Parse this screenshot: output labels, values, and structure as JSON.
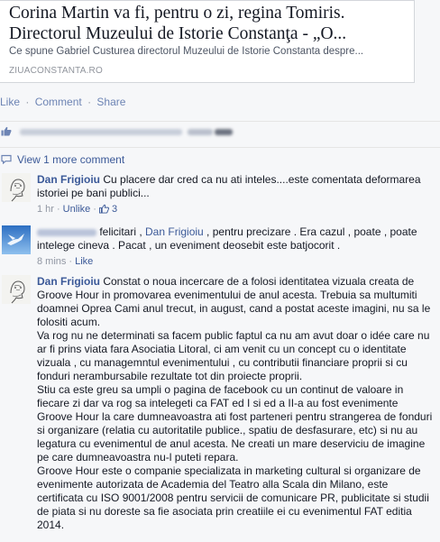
{
  "link_card": {
    "title": "Corina Martin va fi, pentru o zi, regina Tomiris. Directorul Muzeului de Istorie Constanţa - „O...",
    "description": "Ce spune Gabriel Custurea directorul Muzeului de Istorie Constanta despre...",
    "source": "ZIUACONSTANTA.RO"
  },
  "post_actions": {
    "like": "Like",
    "comment": "Comment",
    "share": "Share",
    "separator": "·"
  },
  "view_more": "View 1 more comment",
  "comments": [
    {
      "author": "Dan Frigioiu",
      "text": "Cu placere dar cred ca nu ati inteles....este comentata deformarea istoriei pe bani publici...",
      "time": "1 hr",
      "unlike": "Unlike",
      "like_count": "3"
    },
    {
      "text_before": " felicitari , ",
      "mention": "Dan Frigioiu",
      "text_after": " , pentru precizare . Era cazul , poate , poate intelege cineva . Pacat , un eveniment deosebit este batjocorit .",
      "time": "8 mins",
      "like": "Like"
    },
    {
      "author": "Dan Frigioiu",
      "paragraphs": [
        "Constat o noua incercare de a folosi identitatea vizuala creata de Groove Hour in promovarea evenimentului de anul acesta. Trebuia sa multumiti doamnei Oprea Cami anul trecut, in august, cand a postat aceste imagini, nu sa le folositi acum.",
        "Va rog nu ne determinati sa facem public faptul ca nu am avut doar o idée care nu ar fi prins viata fara Asociatia Litoral, ci am venit cu un concept cu o identitate vizuala , cu managemntul evenimentului , cu contributii financiare proprii si cu fonduri nerambursabile rezultate tot din proiecte proprii.",
        "Stiu ca este greu sa umpli o pagina de facebook cu un continut de valoare in fiecare zi dar va rog sa intelegeti ca FAT ed I si ed a II-a au fost evenimente Groove Hour la care dumneavoastra ati fost parteneri pentru strangerea de fonduri si organizare (relatia cu autoritatile publice., spatiu de desfasurare, etc) si nu au legatura cu evenimentul de anul acesta. Ne creati un mare deserviciu de imagine pe care dumneavoastra nu-l puteti repara.",
        "Groove Hour este o companie specializata in marketing cultural si organizare de evenimente autorizata de Academia del Teatro alla Scala din Milano, este certificata cu ISO 9001/2008 pentru servicii de comunicare PR, publicitate si studii de piata si nu doreste sa fie asociata prin creatiile ei cu evenimentul FAT editia 2014."
      ]
    }
  ],
  "colors": {
    "link": "#3b5998",
    "muted": "#9197a3",
    "action": "#6d84b4"
  }
}
